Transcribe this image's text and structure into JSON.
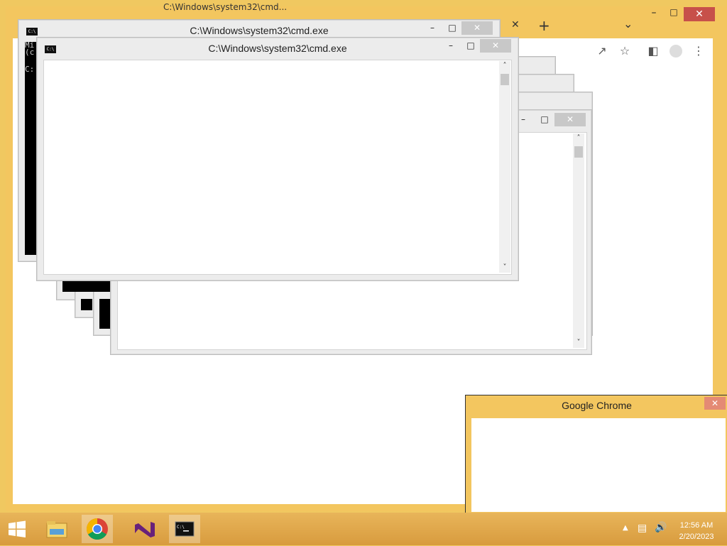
{
  "chrome": {
    "title_fragment": "C:\\Windows\\system32\\cmd...",
    "toolbar_icons": [
      "share-icon",
      "star-icon",
      "side-panel-icon",
      "profile-icon",
      "menu-dots-icon"
    ],
    "tab_strip": {
      "close": "✕",
      "new_tab": "+",
      "dropdown": "⌄"
    }
  },
  "cmd_back": {
    "title": "C:\\Windows\\system32\\cmd.exe",
    "lines": [
      "Mi",
      "(c",
      "",
      "C:"
    ]
  },
  "cmd_front": {
    "title": "C:\\Windows\\system32\\cmd.exe"
  },
  "notification": {
    "title": "Google Chrome",
    "close": "✕"
  },
  "taskbar": {
    "time": "12:56 AM",
    "date": "2/20/2023"
  },
  "colors": {
    "accent": "#f3c65f",
    "close_red": "#c7504a",
    "taskbar": "#e0a84c"
  }
}
